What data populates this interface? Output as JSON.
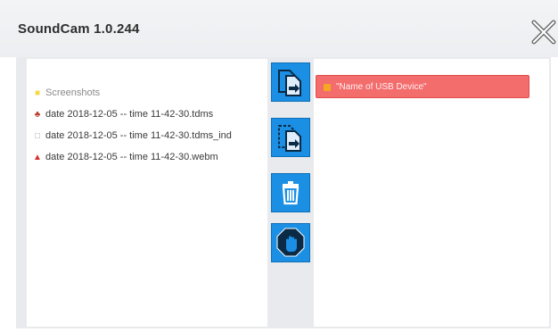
{
  "window": {
    "title": "SoundCam 1.0.244"
  },
  "left_panel": {
    "items": [
      {
        "label": "Screenshots",
        "icon": "folder-icon"
      },
      {
        "label": "date 2018-12-05 -- time 11-42-30.tdms",
        "icon": "tdms-file-icon"
      },
      {
        "label": "date 2018-12-05 -- time 11-42-30.tdms_ind",
        "icon": "index-file-icon"
      },
      {
        "label": "date 2018-12-05 -- time 11-42-30.webm",
        "icon": "video-file-icon"
      }
    ]
  },
  "buttons": [
    {
      "icon": "copy-to-device-icon"
    },
    {
      "icon": "copy-from-device-icon"
    },
    {
      "icon": "trash-icon"
    },
    {
      "icon": "stop-hand-icon"
    }
  ],
  "right_panel": {
    "device_label": "\"Name of USB Device\""
  },
  "colors": {
    "button_blue": "#1a8fe3",
    "device_red": "#f36d6d",
    "folder_yellow": "#f5d94a"
  }
}
